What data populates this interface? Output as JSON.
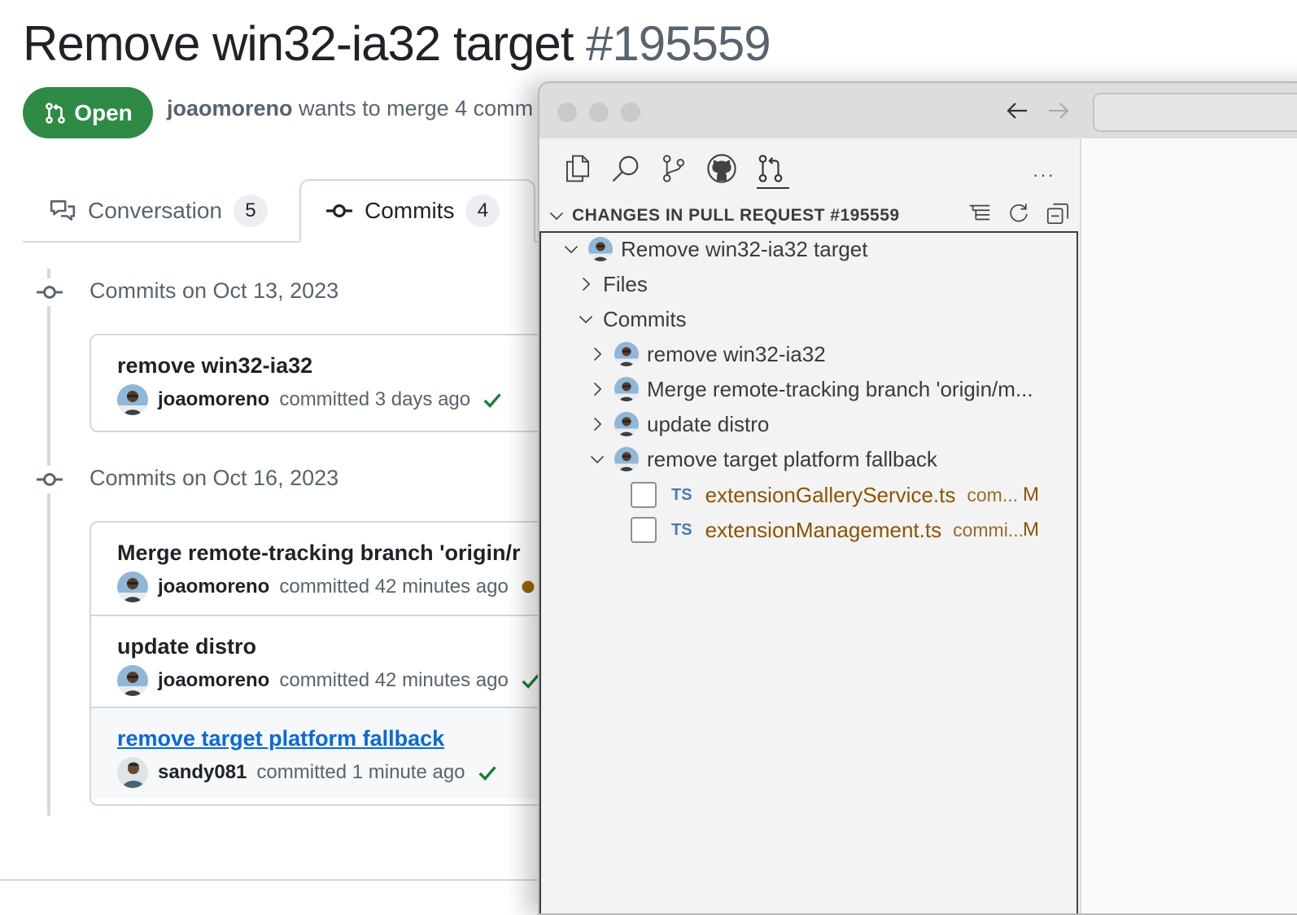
{
  "pr": {
    "title": "Remove win32-ia32 target",
    "number": "#195559",
    "state": "Open",
    "author": "joaomoreno",
    "merge_text": "wants to merge 4 comm"
  },
  "tabs": [
    {
      "label": "Conversation",
      "count": "5"
    },
    {
      "label": "Commits",
      "count": "4"
    }
  ],
  "timeline": [
    {
      "date": "Commits on Oct 13, 2023",
      "commits": [
        {
          "title": "remove win32-ia32",
          "author": "joaomoreno",
          "time": "committed 3 days ago",
          "status": "success"
        }
      ]
    },
    {
      "date": "Commits on Oct 16, 2023",
      "commits": [
        {
          "title": "Merge remote-tracking branch 'origin/r",
          "author": "joaomoreno",
          "time": "committed 42 minutes ago",
          "status": "pending"
        },
        {
          "title": "update distro",
          "author": "joaomoreno",
          "time": "committed 42 minutes ago",
          "status": "success"
        },
        {
          "title": "remove target platform fallback",
          "author": "sandy081",
          "time": "committed 1 minute ago",
          "status": "success"
        }
      ]
    }
  ],
  "vscode": {
    "section_title": "CHANGES IN PULL REQUEST #195559",
    "more_label": "···",
    "activity_icons": [
      "files-icon",
      "search-icon",
      "source-control-icon",
      "github-icon",
      "pull-request-icon"
    ],
    "tree": {
      "root": "Remove win32-ia32 target",
      "files_label": "Files",
      "commits_label": "Commits",
      "commits": [
        {
          "label": "remove win32-ia32",
          "expanded": false
        },
        {
          "label": "Merge remote-tracking branch 'origin/m...",
          "expanded": false
        },
        {
          "label": "update distro",
          "expanded": false
        },
        {
          "label": "remove target platform fallback",
          "expanded": true
        }
      ],
      "files": [
        {
          "lang": "TS",
          "name": "extensionGalleryService.ts",
          "desc": "com...",
          "status": "M"
        },
        {
          "lang": "TS",
          "name": "extensionManagement.ts",
          "desc": "commi...",
          "status": "M"
        }
      ]
    }
  },
  "colors": {
    "open_green": "#2f8a45",
    "link_blue": "#0969da",
    "check_green": "#1a7f37",
    "pending_orange": "#9a6700",
    "modified_file": "#895503"
  }
}
